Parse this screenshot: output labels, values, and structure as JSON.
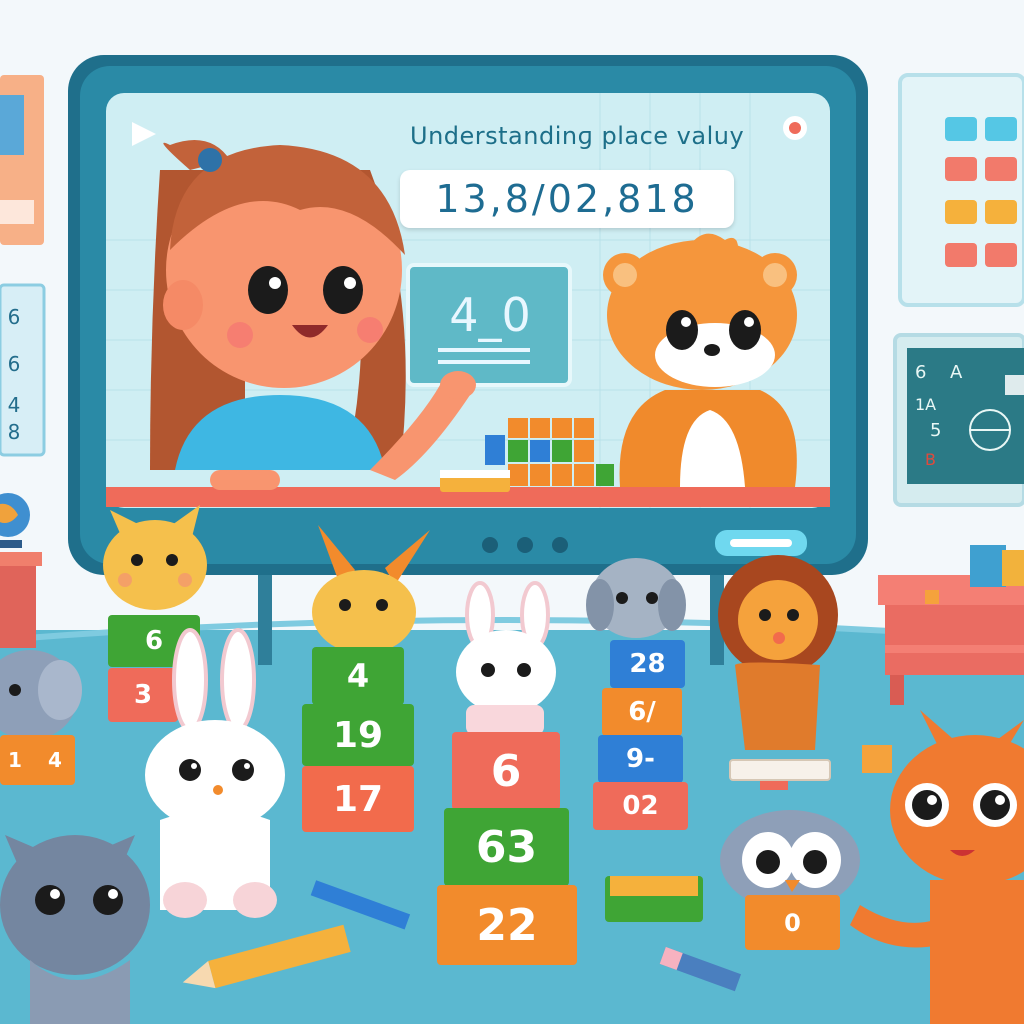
{
  "screen": {
    "title": "Understandinɡ place valuy",
    "number_display": "13,8/02,818",
    "board_value": "4_0"
  },
  "left_chart": {
    "values": [
      "6",
      "6",
      "4",
      "8"
    ]
  },
  "right_board": {
    "scribbles": [
      "6",
      "A",
      "1A",
      "5",
      "B"
    ]
  },
  "blocks": {
    "stack_left": [
      "6",
      "3"
    ],
    "stack_far_left": [
      "1",
      "4"
    ],
    "stack_center_left": [
      "4",
      "19",
      "17"
    ],
    "stack_center": [
      "6",
      "63",
      "22"
    ],
    "stack_right": [
      "28",
      "6/",
      "9-",
      "02"
    ],
    "block_owl": "0"
  },
  "colors": {
    "screen_frame": "#1f6f8b",
    "screen_bg": "#cfeef3",
    "floor": "#5bb8d0",
    "block_green": "#3fa535",
    "block_orange": "#f28b2c",
    "block_red": "#ef6b5a",
    "block_blue": "#2f7fd6"
  }
}
